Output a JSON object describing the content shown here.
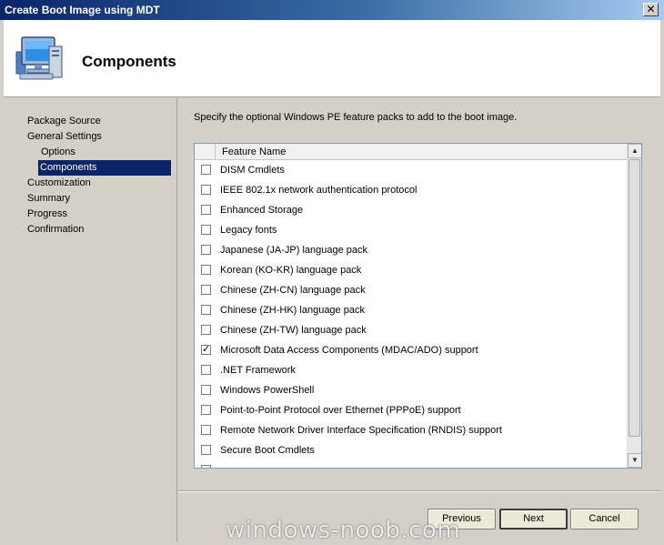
{
  "window": {
    "title": "Create Boot Image using MDT",
    "close_glyph": "✕"
  },
  "header": {
    "title": "Components"
  },
  "nav": {
    "items": [
      {
        "label": "Package Source"
      },
      {
        "label": "General Settings"
      },
      {
        "label": "Options"
      },
      {
        "label": "Components"
      },
      {
        "label": "Customization"
      },
      {
        "label": "Summary"
      },
      {
        "label": "Progress"
      },
      {
        "label": "Confirmation"
      }
    ],
    "selected": "Components"
  },
  "content": {
    "instruction": "Specify the optional Windows PE feature packs to add to the boot image.",
    "list_header": "Feature Name",
    "features": [
      {
        "label": "DISM Cmdlets",
        "checked": false
      },
      {
        "label": "IEEE 802.1x network authentication protocol",
        "checked": false
      },
      {
        "label": "Enhanced Storage",
        "checked": false
      },
      {
        "label": "Legacy fonts",
        "checked": false
      },
      {
        "label": "Japanese (JA-JP) language pack",
        "checked": false
      },
      {
        "label": "Korean (KO-KR) language pack",
        "checked": false
      },
      {
        "label": "Chinese (ZH-CN) language pack",
        "checked": false
      },
      {
        "label": "Chinese (ZH-HK) language pack",
        "checked": false
      },
      {
        "label": "Chinese (ZH-TW) language pack",
        "checked": false
      },
      {
        "label": "Microsoft Data Access Components (MDAC/ADO) support",
        "checked": true
      },
      {
        "label": ".NET Framework",
        "checked": false
      },
      {
        "label": "Windows PowerShell",
        "checked": false
      },
      {
        "label": "Point-to-Point Protocol over Ethernet (PPPoE) support",
        "checked": false
      },
      {
        "label": "Remote Network Driver Interface Specification (RNDIS) support",
        "checked": false
      },
      {
        "label": "Secure Boot Cmdlets",
        "checked": false
      },
      {
        "label": "",
        "checked": false
      }
    ],
    "check_glyph": "✓",
    "scroll_up_glyph": "▲",
    "scroll_down_glyph": "▼"
  },
  "buttons": {
    "previous": "Previous",
    "next": "Next",
    "cancel": "Cancel"
  },
  "watermark": "windows-noob.com"
}
